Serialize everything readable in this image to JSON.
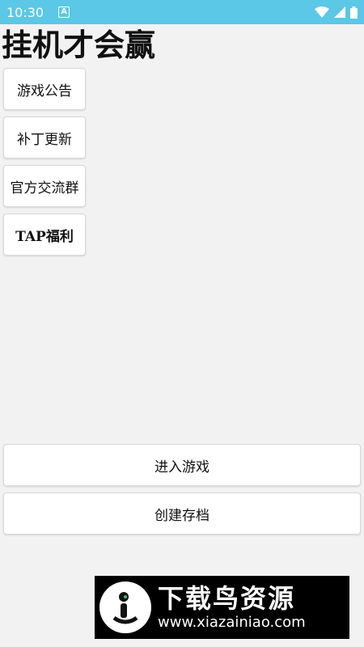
{
  "status_bar": {
    "time": "10:30",
    "notification_icon": "A"
  },
  "page": {
    "title": "挂机才会赢"
  },
  "side_menu": {
    "items": [
      {
        "label": "游戏公告"
      },
      {
        "label": "补丁更新"
      },
      {
        "label": "官方交流群"
      },
      {
        "label": "TAP福利"
      }
    ]
  },
  "actions": {
    "enter_game": "进入游戏",
    "create_save": "创建存档"
  },
  "watermark": {
    "title": "下载鸟资源",
    "url": "www.xiazainiao.com"
  },
  "colors": {
    "status_bar": "#5ac8e6",
    "background": "#f2f2f2",
    "button_bg": "#ffffff"
  }
}
